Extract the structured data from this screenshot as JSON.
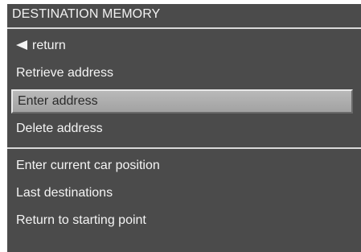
{
  "menu": {
    "title": "DESTINATION MEMORY",
    "items": [
      {
        "label": "return",
        "icon": "arrow-left-icon"
      },
      {
        "label": "Retrieve address"
      },
      {
        "label": "Enter address",
        "selected": true
      },
      {
        "label": "Delete address"
      },
      {
        "label": "Enter current car position"
      },
      {
        "label": "Last destinations"
      },
      {
        "label": "Return to starting point"
      }
    ]
  },
  "colors": {
    "background": "#4b4b4b",
    "text": "#f4f4f4",
    "selection": "#a8a8a8",
    "divider": "#d9d9d9"
  }
}
